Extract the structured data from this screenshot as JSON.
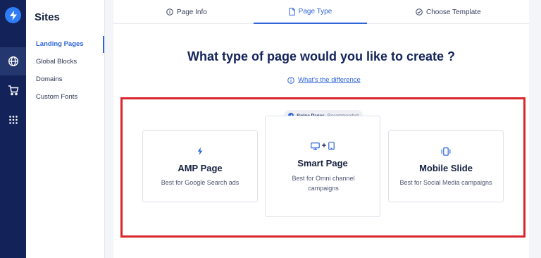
{
  "sidebar": {
    "title": "Sites",
    "items": [
      {
        "label": "Landing Pages",
        "active": true
      },
      {
        "label": "Global Blocks"
      },
      {
        "label": "Domains"
      },
      {
        "label": "Custom Fonts"
      }
    ]
  },
  "tabs": [
    {
      "label": "Page Info",
      "icon": "info-icon"
    },
    {
      "label": "Page Type",
      "icon": "document-icon",
      "active": true
    },
    {
      "label": "Choose Template",
      "icon": "check-circle-icon"
    }
  ],
  "main": {
    "heading": "What type of page would you like to create ?",
    "difference_link": "What's the difference"
  },
  "badge": {
    "brand": "Swipe Pages",
    "label": "Recommended"
  },
  "cards": [
    {
      "name": "AMP Page",
      "description": "Best for Google Search ads",
      "icon": "lightning-icon"
    },
    {
      "name": "Smart Page",
      "description": "Best for Omni channel campaigns",
      "icon": "desktop-plus-mobile-icon",
      "plus": "+"
    },
    {
      "name": "Mobile Slide",
      "description": "Best for Social Media campaigns",
      "icon": "mobile-slide-icon"
    }
  ],
  "colors": {
    "accent": "#2e65d8",
    "rail": "#13235a",
    "highlight": "#d9252b"
  }
}
